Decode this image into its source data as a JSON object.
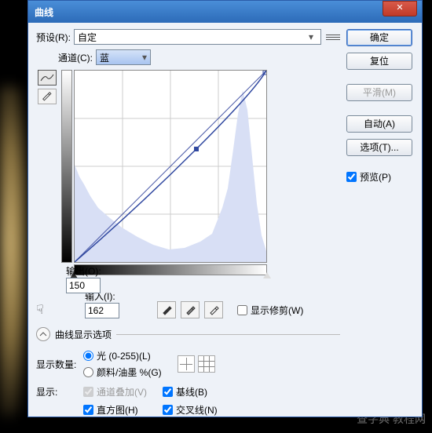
{
  "title": "曲线",
  "preset": {
    "label": "预设(R):",
    "value": "自定"
  },
  "channel": {
    "label": "通道(C):",
    "value": "蓝"
  },
  "output": {
    "label": "输出(O):",
    "value": "150"
  },
  "input": {
    "label": "输入(I):",
    "value": "162"
  },
  "show_clip": "显示修剪(W)",
  "disclosure_label": "曲线显示选项",
  "display_amount": {
    "label": "显示数量:",
    "opt_light": "光 (0-255)(L)",
    "opt_pigment": "颜料/油墨 %(G)"
  },
  "show": {
    "label": "显示:",
    "overlay": "通道叠加(V)",
    "baseline": "基线(B)",
    "histogram": "直方图(H)",
    "intersection": "交叉线(N)"
  },
  "buttons": {
    "ok": "确定",
    "reset": "复位",
    "smooth": "平滑(M)",
    "auto": "自动(A)",
    "options": "选项(T)..."
  },
  "preview": "预览(P)",
  "chart_data": {
    "type": "line",
    "xlabel": "输入",
    "ylabel": "输出",
    "xlim": [
      0,
      255
    ],
    "ylim": [
      0,
      255
    ],
    "points": [
      {
        "x": 0,
        "y": 0
      },
      {
        "x": 162,
        "y": 150
      },
      {
        "x": 255,
        "y": 255
      }
    ],
    "baseline": [
      {
        "x": 0,
        "y": 0
      },
      {
        "x": 255,
        "y": 255
      }
    ],
    "channel": "蓝",
    "histogram_shape": "富边缘分布，两端高中间低，右端峰最高"
  },
  "watermark": "查字典  教程网"
}
